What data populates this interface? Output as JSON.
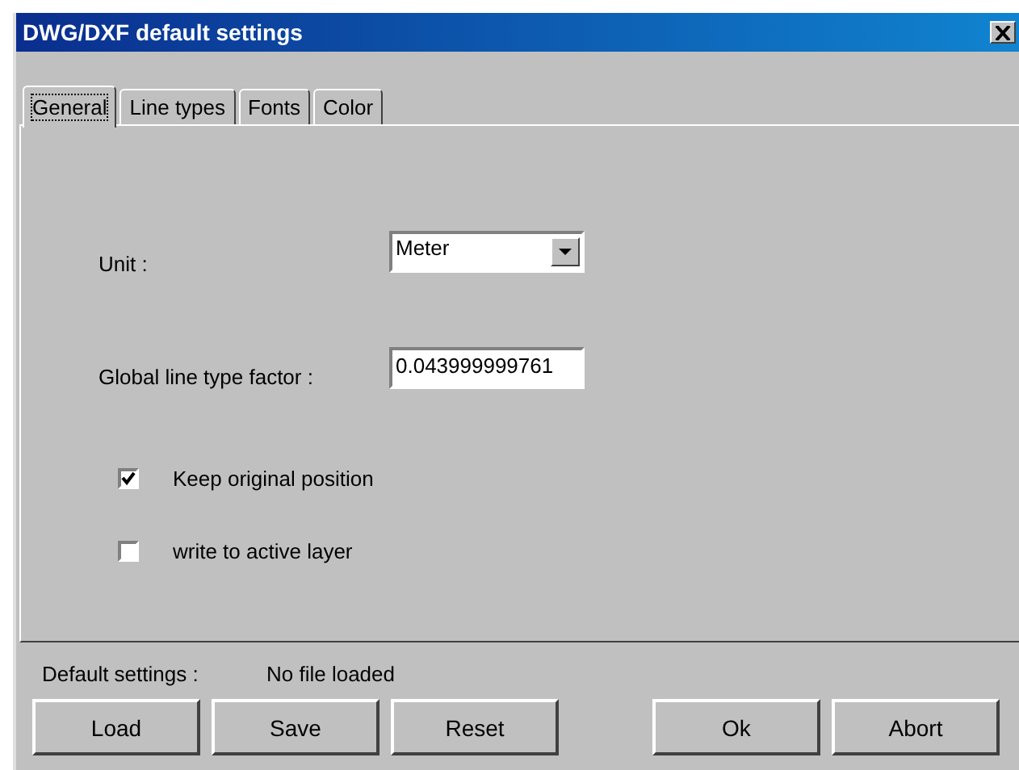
{
  "window": {
    "title": "DWG/DXF default settings"
  },
  "tabs": [
    {
      "label": "General",
      "selected": true
    },
    {
      "label": "Line types",
      "selected": false
    },
    {
      "label": "Fonts",
      "selected": false
    },
    {
      "label": "Color",
      "selected": false
    }
  ],
  "fields": [
    {
      "kind": "dropdown",
      "label": "Unit :",
      "value": "Meter"
    },
    {
      "kind": "text",
      "label": "Global line type factor :",
      "value": "0.043999999761"
    }
  ],
  "checkboxes": [
    {
      "label": "Keep original position",
      "checked": true
    },
    {
      "label": "write to active layer",
      "checked": false
    }
  ],
  "status": {
    "label": "Default settings :",
    "value": "No file loaded"
  },
  "left_buttons": [
    "Load",
    "Save",
    "Reset"
  ],
  "right_buttons": [
    "Ok",
    "Abort"
  ]
}
